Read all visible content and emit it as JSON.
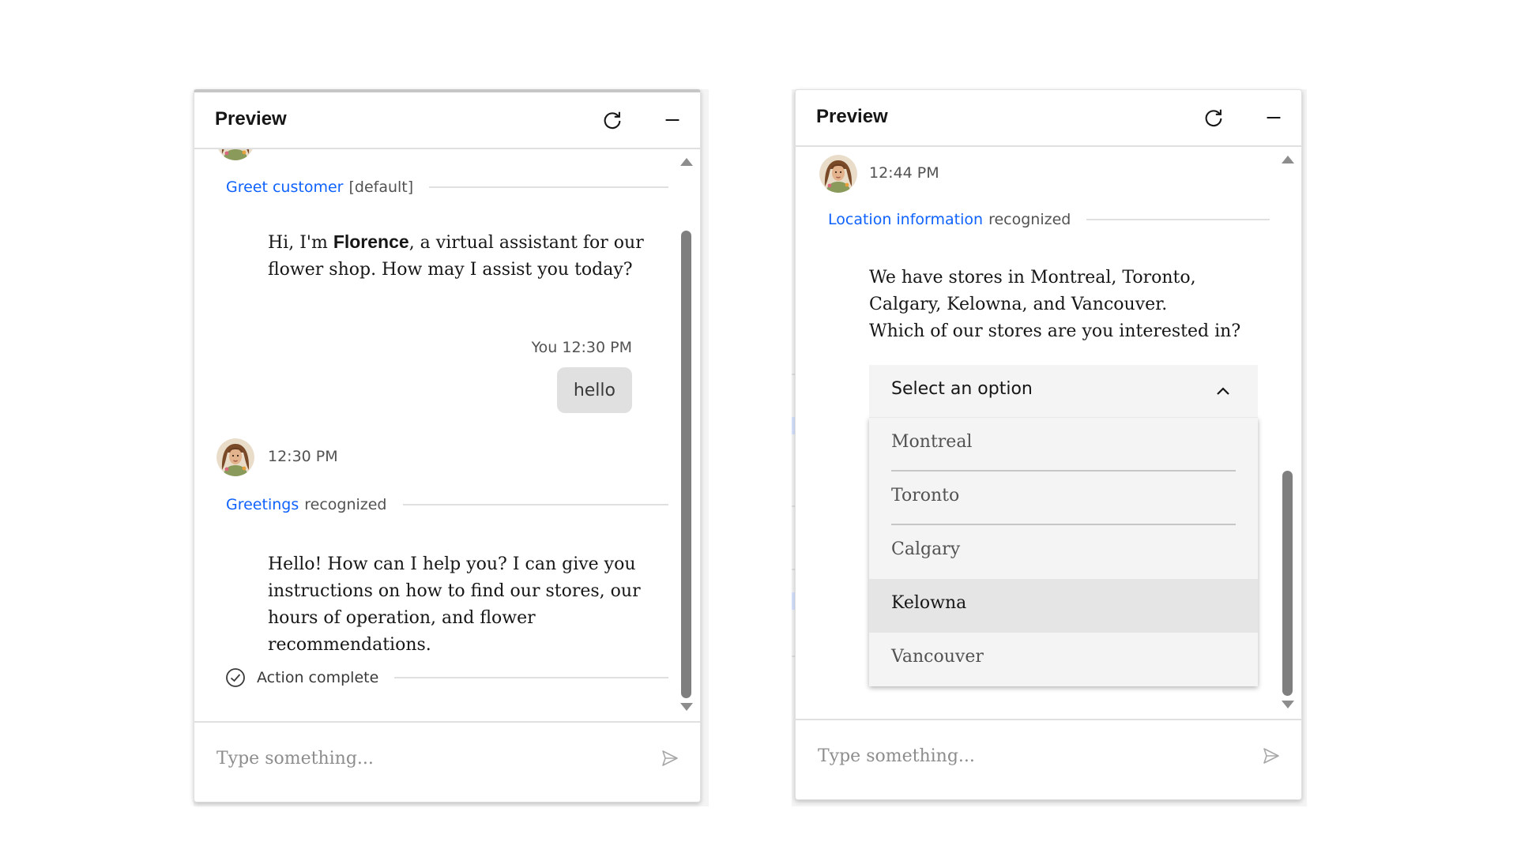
{
  "left_panel": {
    "title": "Preview",
    "icons": {
      "refresh": "refresh-icon",
      "minimize": "minimize-icon"
    },
    "greet": {
      "link": "Greet customer",
      "suffix": "[default]"
    },
    "greet_message": {
      "before": "Hi, I'm ",
      "bold": "Florence",
      "after": ", a virtual assistant for our flower shop. How may I assist you today?"
    },
    "user_meta": "You 12:30 PM",
    "user_message": "hello",
    "bot_time": "12:30 PM",
    "recognized": {
      "link": "Greetings",
      "suffix": "recognized"
    },
    "bot_message": "Hello! How can I help you? I can give you instructions on how to find our stores, our hours of operation, and flower recommendations.",
    "action_complete": "Action complete",
    "input_placeholder": "Type something..."
  },
  "right_panel": {
    "title": "Preview",
    "icons": {
      "refresh": "refresh-icon",
      "minimize": "minimize-icon"
    },
    "bot_time": "12:44 PM",
    "recognized": {
      "link": "Location information",
      "suffix": "recognized"
    },
    "message_line1": "We have stores in Montreal, Toronto, Calgary, Kelowna, and Vancouver.",
    "message_line2": "Which of our stores are you interested in?",
    "dropdown": {
      "label": "Select an option",
      "expanded": true,
      "options": [
        "Montreal",
        "Toronto",
        "Calgary",
        "Kelowna",
        "Vancouver"
      ],
      "highlighted": "Kelowna"
    },
    "input_placeholder": "Type something..."
  },
  "colors": {
    "link": "#0f62fe",
    "user_bubble": "#e0e0e0",
    "dropdown_bg": "#f4f4f4",
    "highlight_bg": "#e5e5e5"
  }
}
